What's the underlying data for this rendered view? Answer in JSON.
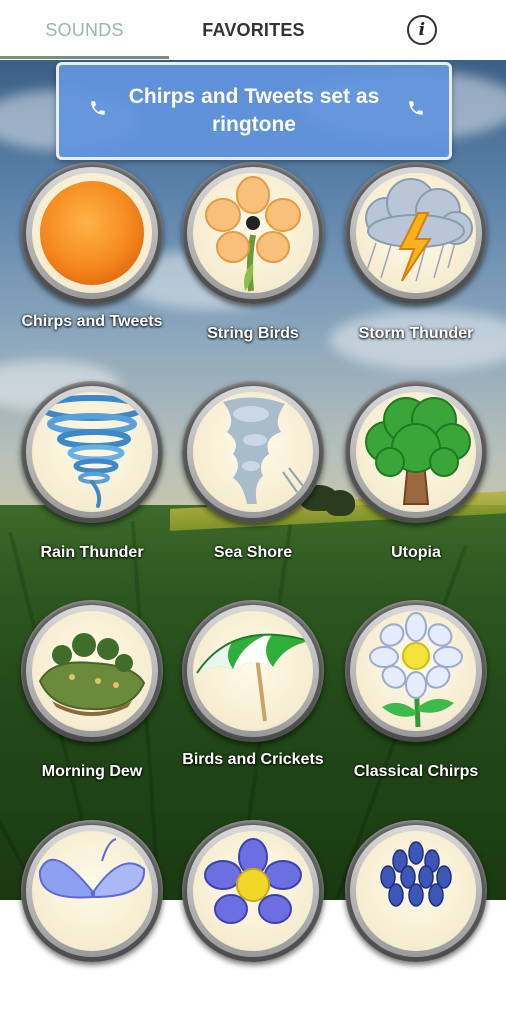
{
  "tabs": {
    "sounds": "SOUNDS",
    "favorites": "FAVORITES",
    "info_icon": "info-icon",
    "info_glyph": "i"
  },
  "toast": {
    "message": "Chirps and Tweets set as ringtone",
    "icon": "phone-icon"
  },
  "sounds": [
    {
      "label": "Chirps and Tweets",
      "icon": "sun-icon"
    },
    {
      "label": "String Birds",
      "icon": "flower-icon"
    },
    {
      "label": "Storm Thunder",
      "icon": "storm-cloud-icon"
    },
    {
      "label": "Rain Thunder",
      "icon": "tornado-icon"
    },
    {
      "label": "Sea Shore",
      "icon": "whirlwind-icon"
    },
    {
      "label": "Utopia",
      "icon": "tree-icon"
    },
    {
      "label": "Morning Dew",
      "icon": "island-icon"
    },
    {
      "label": "Birds and Crickets",
      "icon": "umbrella-icon"
    },
    {
      "label": "Classical Chirps",
      "icon": "daisy-icon"
    },
    {
      "label": "",
      "icon": "butterfly-icon"
    },
    {
      "label": "",
      "icon": "blue-flower-icon"
    },
    {
      "label": "",
      "icon": "bluebells-icon"
    }
  ],
  "colors": {
    "toast_bg": "#6295e0",
    "tab_active": "#9db6a5",
    "tab_inactive": "#333333"
  }
}
